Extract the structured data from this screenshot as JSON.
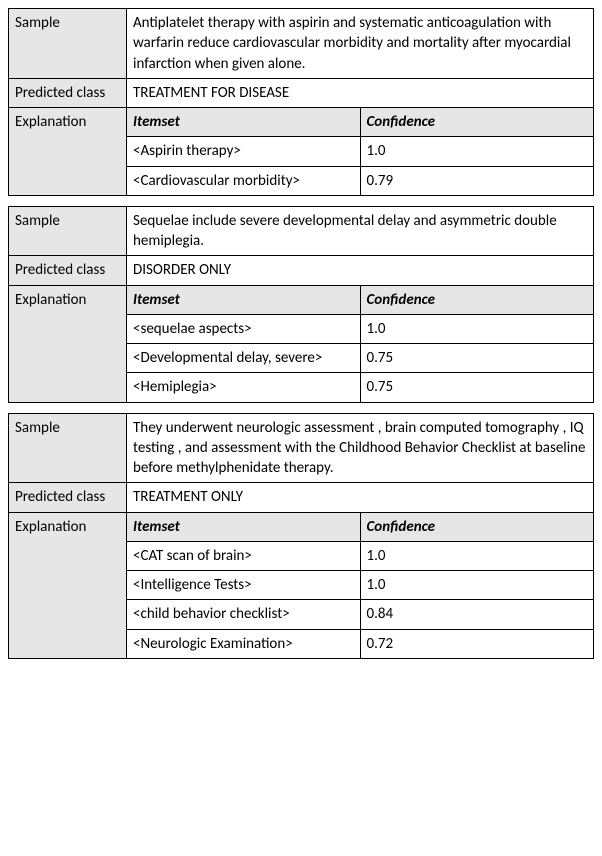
{
  "labels": {
    "sample": "Sample",
    "predicted_class": "Predicted class",
    "explanation": "Explanation",
    "itemset": "Itemset",
    "confidence": "Confidence"
  },
  "blocks": [
    {
      "sample": "Antiplatelet therapy with aspirin and systematic anticoagulation with warfarin reduce cardiovascular morbidity and mortality after myocardial infarction when given alone.",
      "predicted_class": "TREATMENT FOR DISEASE",
      "explanation": [
        {
          "itemset": "<Aspirin therapy>",
          "confidence": "1.0"
        },
        {
          "itemset": "<Cardiovascular morbidity>",
          "confidence": "0.79"
        }
      ]
    },
    {
      "sample": "Sequelae include severe developmental delay and asymmetric double hemiplegia.",
      "predicted_class": "DISORDER ONLY",
      "explanation": [
        {
          "itemset": "<sequelae aspects>",
          "confidence": "1.0"
        },
        {
          "itemset": "<Developmental delay, severe>",
          "confidence": "0.75"
        },
        {
          "itemset": "<Hemiplegia>",
          "confidence": "0.75"
        }
      ]
    },
    {
      "sample": "They underwent neurologic assessment , brain computed tomography , IQ testing , and assessment with the Childhood Behavior Checklist at baseline before methylphenidate therapy.",
      "predicted_class": "TREATMENT ONLY",
      "explanation": [
        {
          "itemset": "<CAT scan of brain>",
          "confidence": "1.0"
        },
        {
          "itemset": "<Intelligence Tests>",
          "confidence": "1.0"
        },
        {
          "itemset": "<child behavior checklist>",
          "confidence": "0.84"
        },
        {
          "itemset": "<Neurologic Examination>",
          "confidence": "0.72"
        }
      ]
    }
  ]
}
